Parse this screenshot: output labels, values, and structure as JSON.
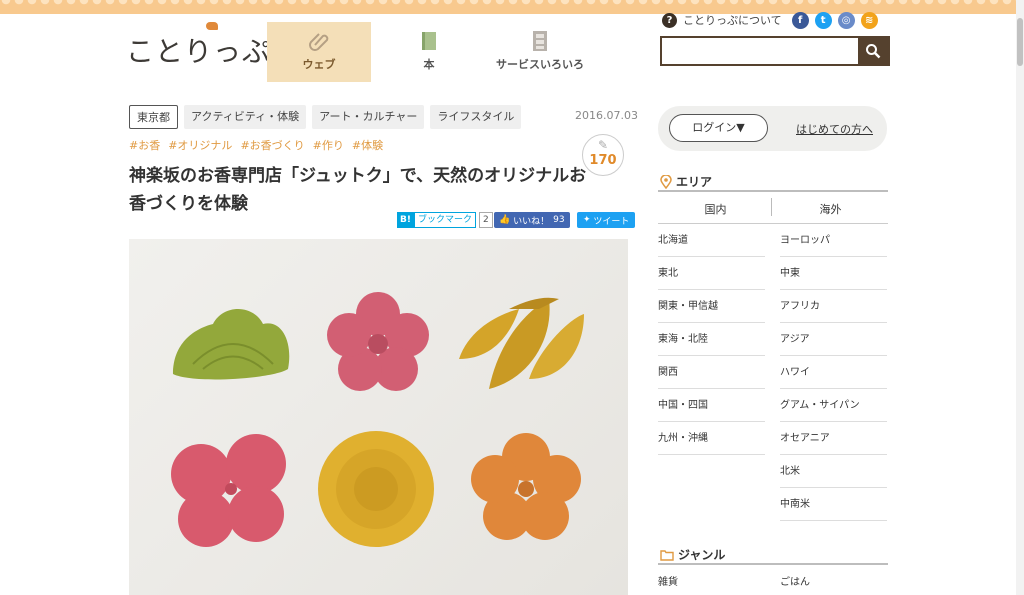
{
  "brand": {
    "logo": "ことりっぷ"
  },
  "nav": [
    {
      "label": "ウェブ",
      "icon": "clip-icon",
      "active": true
    },
    {
      "label": "本",
      "icon": "book-icon",
      "active": false
    },
    {
      "label": "サービスいろいろ",
      "icon": "cabinet-icon",
      "active": false
    }
  ],
  "header": {
    "about_label": "ことりっぷについて",
    "about_icon": "?",
    "social": [
      {
        "name": "facebook-icon",
        "glyph": "f",
        "color": "#3b5998"
      },
      {
        "name": "twitter-icon",
        "glyph": "t",
        "color": "#1da1f2"
      },
      {
        "name": "instagram-icon",
        "glyph": "◎",
        "color": "#6a8bc9"
      },
      {
        "name": "rss-icon",
        "glyph": "≋",
        "color": "#f2a31b"
      }
    ],
    "search_placeholder": ""
  },
  "article": {
    "area_tag": "東京都",
    "category_tags": [
      "アクティビティ・体験",
      "アート・カルチャー",
      "ライフスタイル"
    ],
    "date": "2016.07.03",
    "hashtags": [
      "#お香",
      "#オリジナル",
      "#お香づくり",
      "#作り",
      "#体験"
    ],
    "clip_count": "170",
    "title": "神楽坂のお香専門店「ジュットク」で、天然のオリジナルお香づくりを体験",
    "share": {
      "hatena_label": "B!",
      "bookmark_label": "ブックマーク",
      "bookmark_count": "2",
      "like_label": "いいね！",
      "like_count": "93",
      "tweet_label": "ツイート"
    }
  },
  "sidebar": {
    "login_label": "ログイン▼",
    "first_time_label": "はじめての方へ",
    "area_heading": "エリア",
    "area_tabs": [
      "国内",
      "海外"
    ],
    "domestic": [
      "北海道",
      "東北",
      "関東・甲信越",
      "東海・北陸",
      "関西",
      "中国・四国",
      "九州・沖縄"
    ],
    "overseas": [
      "ヨーロッパ",
      "中東",
      "アフリカ",
      "アジア",
      "ハワイ",
      "グアム・サイパン",
      "オセアニア",
      "北米",
      "中南米"
    ],
    "genre_heading": "ジャンル",
    "genres": [
      "雑貨",
      "ごはん"
    ]
  },
  "colors": {
    "accent": "#e09a42",
    "nav_active_bg": "#f4dfb8",
    "search_border": "#55412e"
  }
}
